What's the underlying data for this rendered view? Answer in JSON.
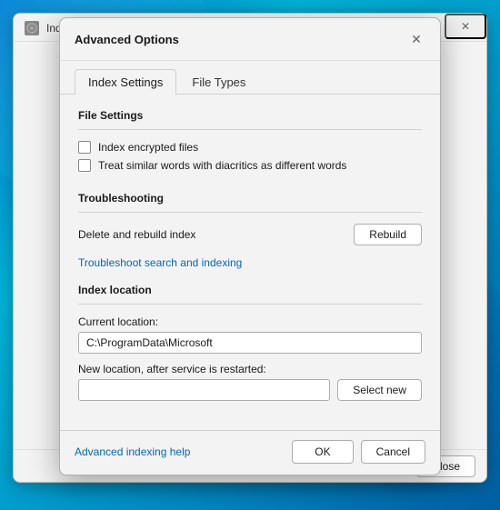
{
  "outer_window": {
    "title": "Indexing Options",
    "close_label": "Close"
  },
  "dialog": {
    "title": "Advanced Options",
    "close_symbol": "✕",
    "tabs": [
      {
        "label": "Index Settings",
        "active": true
      },
      {
        "label": "File Types",
        "active": false
      }
    ],
    "file_settings": {
      "section_title": "File Settings",
      "checkbox1_label": "Index encrypted files",
      "checkbox2_label": "Treat similar words with diacritics as different words"
    },
    "troubleshooting": {
      "section_title": "Troubleshooting",
      "delete_rebuild_label": "Delete and rebuild index",
      "rebuild_button_label": "Rebuild",
      "link_label": "Troubleshoot search and indexing"
    },
    "index_location": {
      "section_title": "Index location",
      "current_location_label": "Current location:",
      "current_location_value": "C:\\ProgramData\\Microsoft",
      "new_location_label": "New location, after service is restarted:",
      "new_location_value": "",
      "select_new_label": "Select new"
    },
    "footer": {
      "help_link": "Advanced indexing help",
      "ok_label": "OK",
      "cancel_label": "Cancel"
    }
  }
}
